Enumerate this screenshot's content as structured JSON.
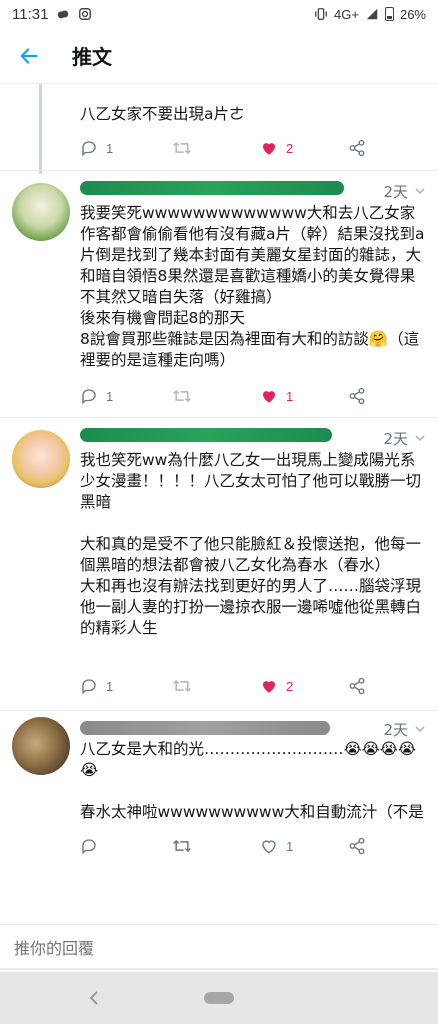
{
  "status_bar": {
    "time": "11:31",
    "network": "4G+",
    "battery": "26%"
  },
  "header": {
    "title": "推文"
  },
  "tweets": [
    {
      "text": "八乙女家不要出現a片ㄜ",
      "replies": "1",
      "likes": "2"
    },
    {
      "time": "2天",
      "text": "我要笑死wwwwwwwwwwwww大和去八乙女家作客都會偷偷看他有沒有藏a片（幹）結果沒找到a片倒是找到了幾本封面有美麗女星封面的雜誌，大和暗自領悟8果然還是喜歡這種嬌小的美女覺得果不其然又暗自失落（好雞搞）\n後來有機會問起8的那天\n8說會買那些雜誌是因為裡面有大和的訪談🤗（這裡要的是這種走向嗎）",
      "replies": "1",
      "likes": "1"
    },
    {
      "time": "2天",
      "text": "我也笑死ww為什麼八乙女一出現馬上變成陽光系少女漫畫！！！！八乙女太可怕了他可以戰勝一切黑暗\n\n大和真的是受不了他只能臉紅＆投懷送抱，他每一個黑暗的想法都會被八乙女化為春水（春水）\n大和再也沒有辦法找到更好的男人了……腦袋浮現他一副人妻的打扮一邊掠衣服一邊唏噓他從黑轉白的精彩人生",
      "replies": "1",
      "likes": "2"
    },
    {
      "time": "2天",
      "text": "八乙女是大和的光………………………😭😭😭😭😭\n\n春水太神啦wwwwwwwwww大和自動流汁（不是",
      "replies": "",
      "likes": "1"
    }
  ],
  "reply_bar": {
    "placeholder": "推你的回覆"
  },
  "colors": {
    "accent": "#1da1f2",
    "like": "#e0245e",
    "muted": "#657786"
  }
}
